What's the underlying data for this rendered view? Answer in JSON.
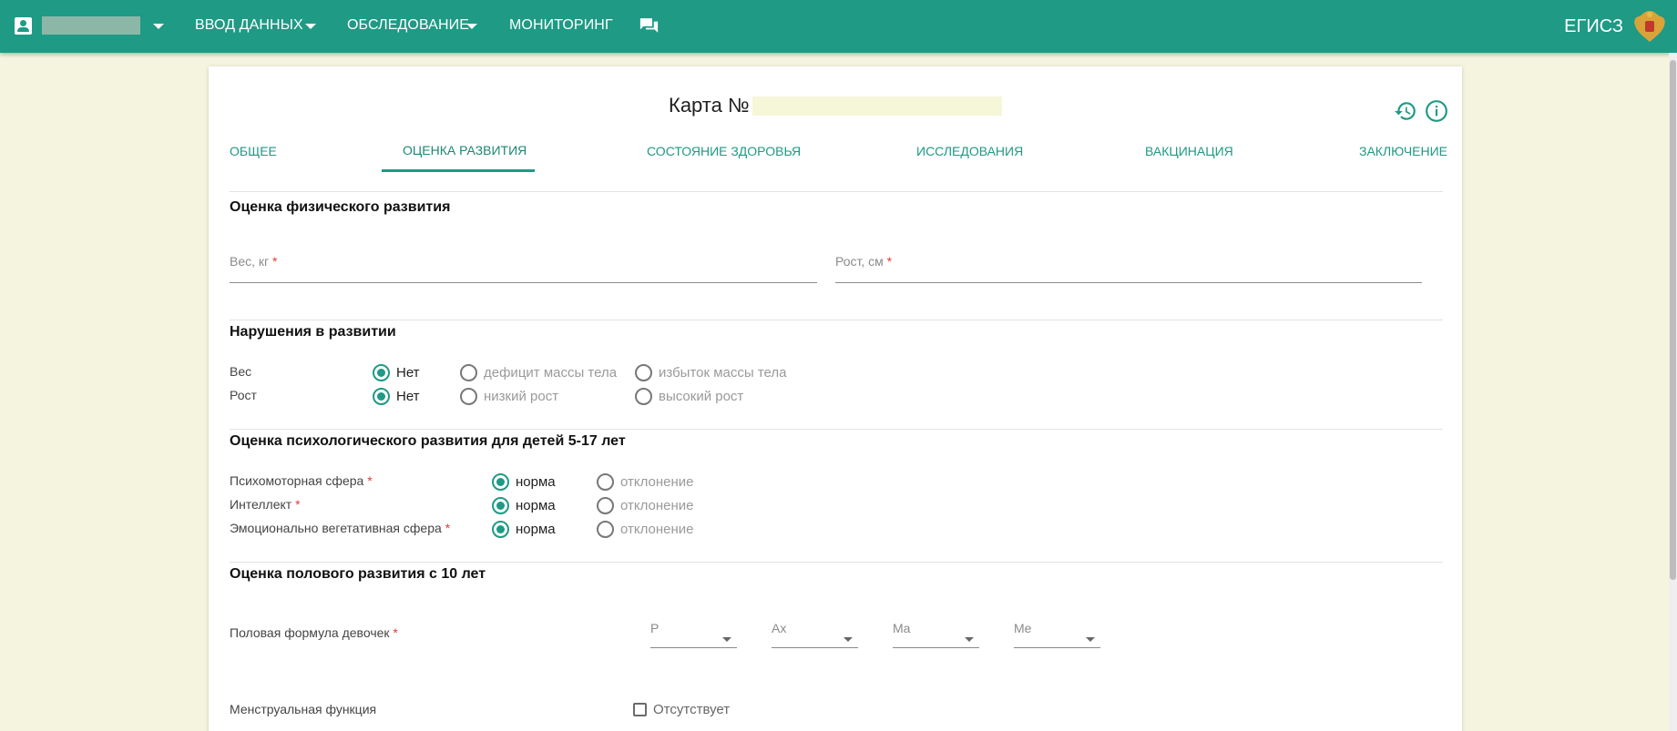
{
  "topbar": {
    "menu": [
      "ВВОД ДАННЫХ",
      "ОБСЛЕДОВАНИЕ",
      "МОНИТОРИНГ"
    ],
    "brand": "ЕГИСЗ"
  },
  "card": {
    "title": "Карта №",
    "tabs": [
      "ОБЩЕЕ",
      "ОЦЕНКА РАЗВИТИЯ",
      "СОСТОЯНИЕ ЗДОРОВЬЯ",
      "ИССЛЕДОВАНИЯ",
      "ВАКЦИНАЦИЯ",
      "ЗАКЛЮЧЕНИЕ"
    ],
    "active_tab": "ОЦЕНКА РАЗВИТИЯ"
  },
  "physical": {
    "title": "Оценка физического развития",
    "weight_label": "Вес, кг",
    "height_label": "Рост, см",
    "required_mark": "*"
  },
  "disorders": {
    "title": "Нарушения в развитии",
    "weight": {
      "label": "Вес",
      "options": [
        "Нет",
        "дефицит массы тела",
        "избыток массы тела"
      ],
      "selected": "Нет"
    },
    "height": {
      "label": "Рост",
      "options": [
        "Нет",
        "низкий рост",
        "высокий рост"
      ],
      "selected": "Нет"
    }
  },
  "psych": {
    "title": "Оценка психологического развития для детей 5-17 лет",
    "rows": [
      {
        "label": "Психомоторная сфера",
        "options": [
          "норма",
          "отклонение"
        ],
        "selected": "норма"
      },
      {
        "label": "Интеллект",
        "options": [
          "норма",
          "отклонение"
        ],
        "selected": "норма"
      },
      {
        "label": "Эмоционально вегетативная сфера",
        "options": [
          "норма",
          "отклонение"
        ],
        "selected": "норма"
      }
    ]
  },
  "sexual": {
    "title": "Оценка полового развития с 10 лет",
    "formula_label": "Половая формула девочек",
    "selects": [
      "P",
      "Ax",
      "Ma",
      "Me"
    ],
    "menstrual_label": "Менструальная функция",
    "absent_label": "Отсутствует",
    "absent_checked": false
  },
  "colors": {
    "primary": "#1e9a85",
    "background": "#f4f4df",
    "required": "#e53935"
  }
}
